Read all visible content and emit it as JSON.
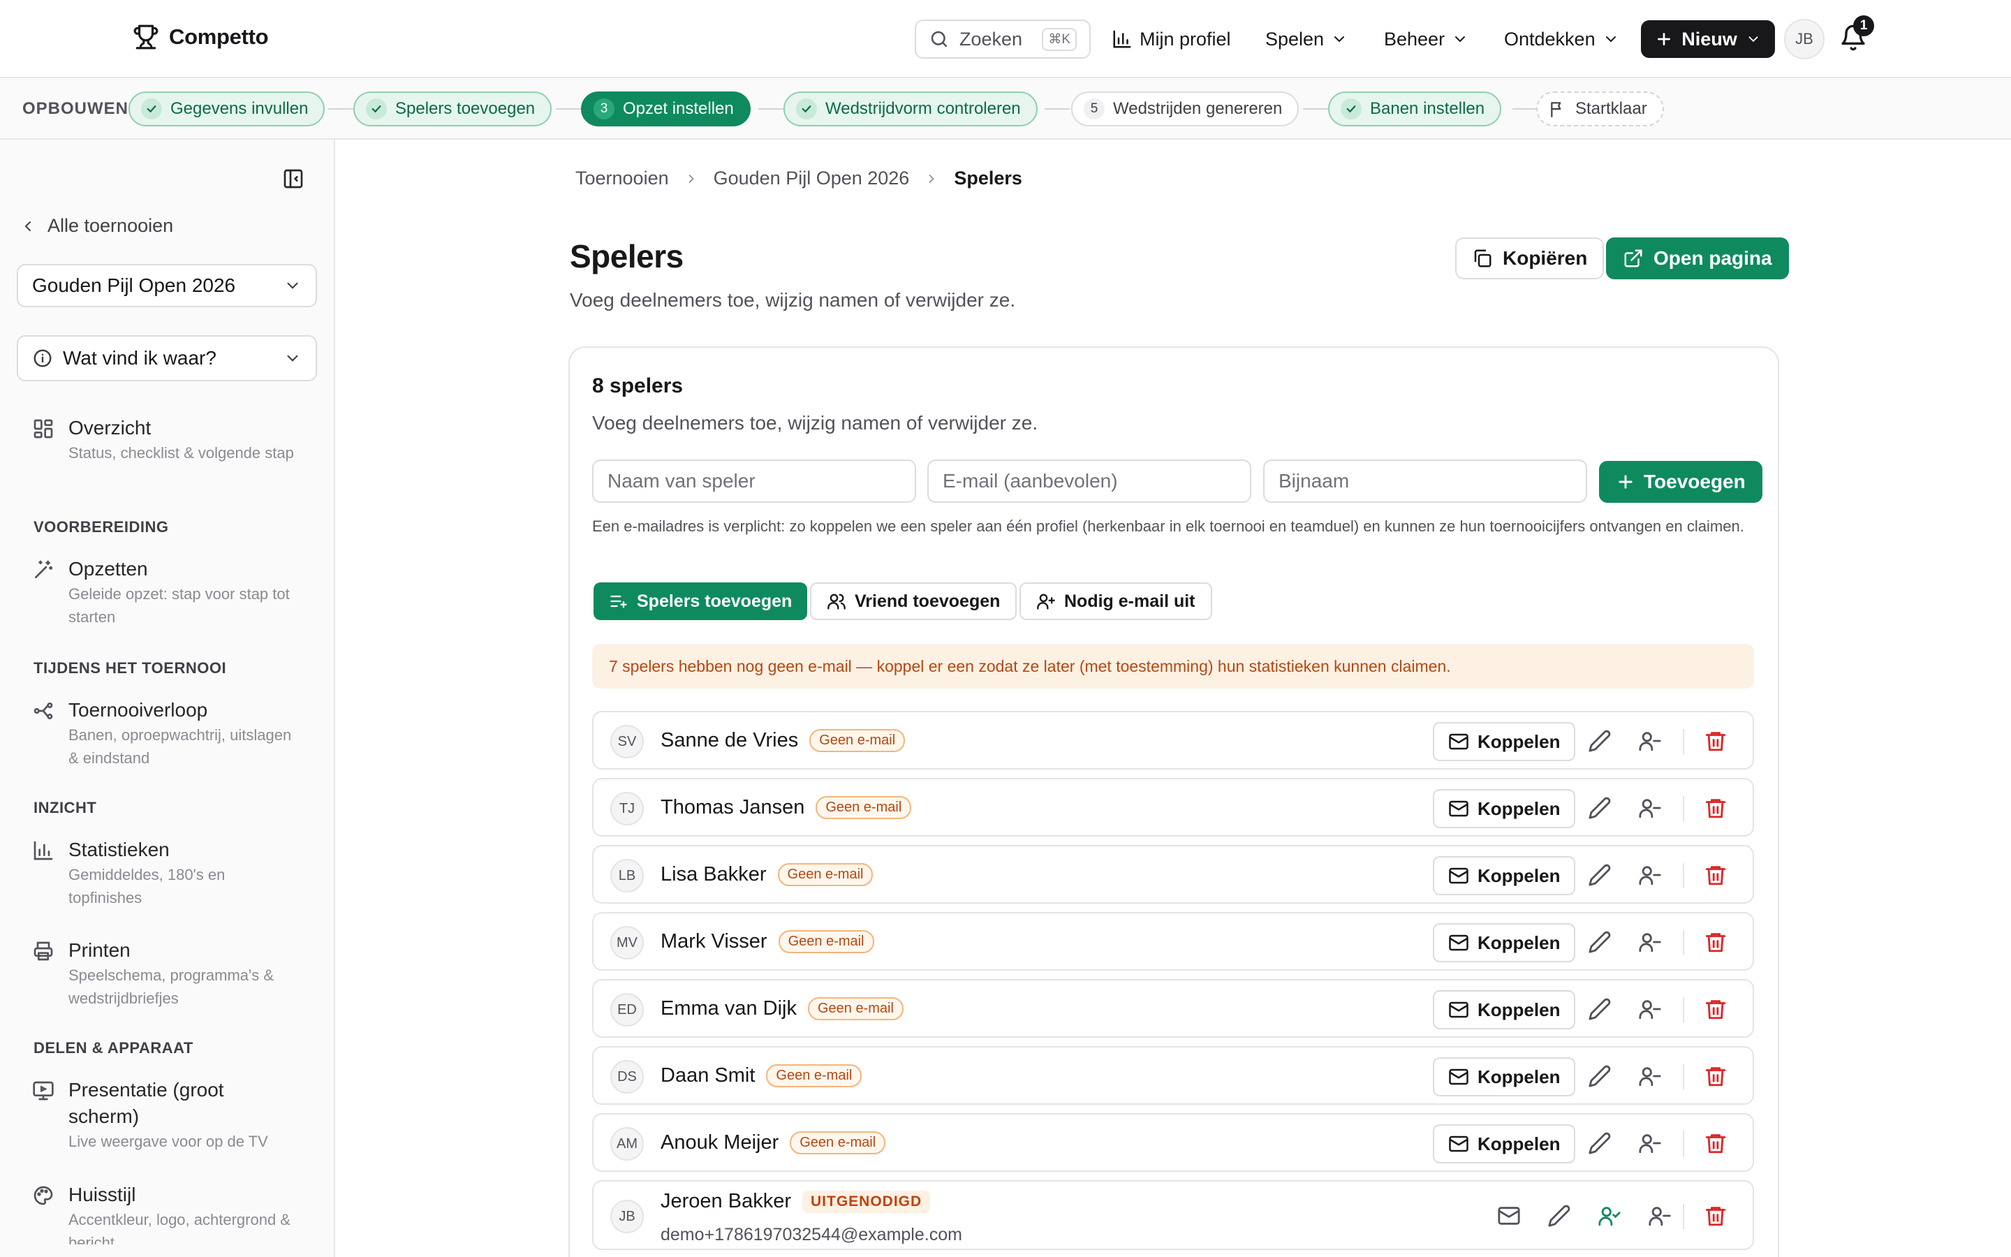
{
  "app": {
    "name": "Competto"
  },
  "header": {
    "search_label": "Zoeken",
    "search_shortcut": "⌘K",
    "nav": [
      "Mijn profiel",
      "Spelen",
      "Beheer",
      "Ontdekken"
    ],
    "new_button": "Nieuw",
    "avatar_initials": "JB",
    "notification_count": "1"
  },
  "steps": {
    "label": "OPBOUWEN",
    "items": [
      {
        "label": "Gegevens invullen",
        "state": "done"
      },
      {
        "label": "Spelers toevoegen",
        "state": "done"
      },
      {
        "label": "Opzet instellen",
        "state": "active",
        "number": "3"
      },
      {
        "label": "Wedstrijdvorm controleren",
        "state": "done"
      },
      {
        "label": "Wedstrijden genereren",
        "state": "todo",
        "number": "5"
      },
      {
        "label": "Banen instellen",
        "state": "done"
      },
      {
        "label": "Startklaar",
        "state": "final"
      }
    ]
  },
  "sidebar": {
    "back_label": "Alle toernooien",
    "tournament_select": "Gouden Pijl Open 2026",
    "help_select": "Wat vind ik waar?",
    "overview": {
      "title": "Overzicht",
      "desc": "Status, checklist & volgende stap"
    },
    "sections": [
      {
        "label": "VOORBEREIDING",
        "items": [
          {
            "title": "Opzetten",
            "desc": "Geleide opzet: stap voor stap tot starten"
          }
        ]
      },
      {
        "label": "TIJDENS HET TOERNOOI",
        "items": [
          {
            "title": "Toernooiverloop",
            "desc": "Banen, oproepwachtrij, uitslagen & eindstand"
          }
        ]
      },
      {
        "label": "INZICHT",
        "items": [
          {
            "title": "Statistieken",
            "desc": "Gemiddeldes, 180's en topfinishes"
          },
          {
            "title": "Printen",
            "desc": "Speelschema, programma's & wedstrijdbriefjes"
          }
        ]
      },
      {
        "label": "DELEN & APPARAAT",
        "items": [
          {
            "title": "Presentatie (groot scherm)",
            "desc": "Live weergave voor op de TV"
          },
          {
            "title": "Huisstijl",
            "desc": "Accentkleur, logo, achtergrond & bericht"
          }
        ]
      }
    ]
  },
  "breadcrumb": [
    "Toernooien",
    "Gouden Pijl Open 2026",
    "Spelers"
  ],
  "page": {
    "title": "Spelers",
    "subtitle": "Voeg deelnemers toe, wijzig namen of verwijder ze.",
    "copy_button": "Kopiëren",
    "open_button": "Open pagina"
  },
  "card": {
    "title": "8 spelers",
    "subtitle": "Voeg deelnemers toe, wijzig namen of verwijder ze.",
    "name_placeholder": "Naam van speler",
    "email_placeholder": "E-mail (aanbevolen)",
    "nickname_placeholder": "Bijnaam",
    "add_button": "Toevoegen",
    "hint": "Een e-mailadres is verplicht: zo koppelen we een speler aan één profiel (herkenbaar in elk toernooi en teamduel) en kunnen ze hun toernooicijfers ontvangen en claimen.",
    "tabs": [
      "Spelers toevoegen",
      "Vriend toevoegen",
      "Nodig e-mail uit"
    ],
    "warning": "7 spelers hebben nog geen e-mail — koppel er een zodat ze later (met toestemming) hun statistieken kunnen claimen.",
    "link_label": "Koppelen",
    "players": [
      {
        "initials": "SV",
        "name": "Sanne de Vries",
        "badge": "Geen e-mail"
      },
      {
        "initials": "TJ",
        "name": "Thomas Jansen",
        "badge": "Geen e-mail"
      },
      {
        "initials": "LB",
        "name": "Lisa Bakker",
        "badge": "Geen e-mail"
      },
      {
        "initials": "MV",
        "name": "Mark Visser",
        "badge": "Geen e-mail"
      },
      {
        "initials": "ED",
        "name": "Emma van Dijk",
        "badge": "Geen e-mail"
      },
      {
        "initials": "DS",
        "name": "Daan Smit",
        "badge": "Geen e-mail"
      },
      {
        "initials": "AM",
        "name": "Anouk Meijer",
        "badge": "Geen e-mail"
      },
      {
        "initials": "JB",
        "name": "Jeroen Bakker",
        "badge": "UITGENODIGD",
        "email": "demo+1786197032544@example.com"
      }
    ]
  },
  "colors": {
    "accent": "#0f8a5f",
    "dark": "#18181b",
    "warning_text": "#b5480f",
    "warning_bg": "#fdf1e4",
    "danger": "#dc2626"
  }
}
